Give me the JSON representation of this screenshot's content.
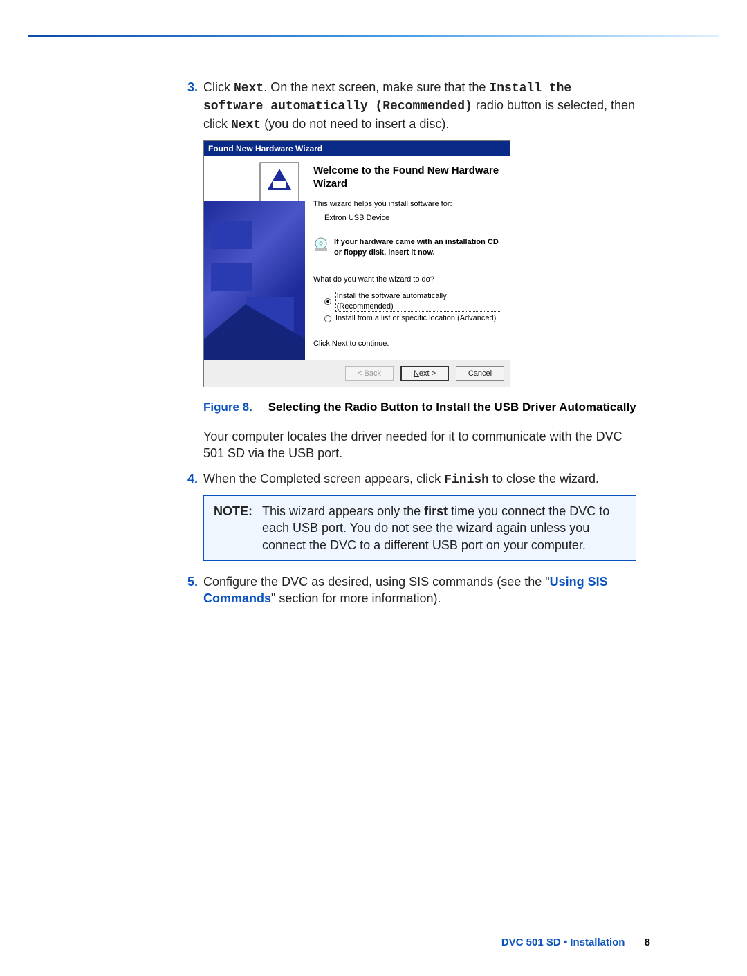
{
  "steps": {
    "s3": {
      "num": "3.",
      "pre": "Click ",
      "next1": "Next",
      "mid1": ". On the next screen, make sure that the ",
      "mono1": "Install the software automatically (Recommended)",
      "mid2": " radio button is selected, then click ",
      "next2": "Next",
      "post": " (you do not need to insert a disc)."
    },
    "s4": {
      "num": "4.",
      "pre": "When the Completed screen appears, click ",
      "mono": "Finish",
      "post": " to close the wizard."
    },
    "s5": {
      "num": "5.",
      "pre": "Configure the DVC as desired, using SIS commands (see the \"",
      "link": "Using SIS Commands",
      "post": "\" section for more information)."
    }
  },
  "wizard": {
    "title": "Found New Hardware Wizard",
    "heading": "Welcome to the Found New Hardware Wizard",
    "intro": "This wizard helps you install software for:",
    "device": "Extron USB Device",
    "cd_notice": "If your hardware came with an installation CD or floppy disk, insert it now.",
    "prompt": "What do you want the wizard to do?",
    "opt1": "Install the software automatically (Recommended)",
    "opt2": "Install from a list or specific location (Advanced)",
    "continue": "Click Next to continue.",
    "back": "< Back",
    "next_u": "N",
    "next_rest": "ext >",
    "cancel": "Cancel"
  },
  "figure": {
    "label": "Figure 8.",
    "title": "Selecting the Radio Button to Install the USB Driver Automatically"
  },
  "para_after_fig": "Your computer locates the driver needed for it to communicate with the DVC 501 SD via the USB port.",
  "note": {
    "label": "NOTE:",
    "pre": "This wizard appears only the ",
    "bold": "first",
    "post": " time you connect the DVC to each USB port. You do not see the wizard again unless you connect the DVC to a different USB port on your computer."
  },
  "footer": {
    "text": "DVC 501 SD • Installation",
    "page": "8"
  }
}
